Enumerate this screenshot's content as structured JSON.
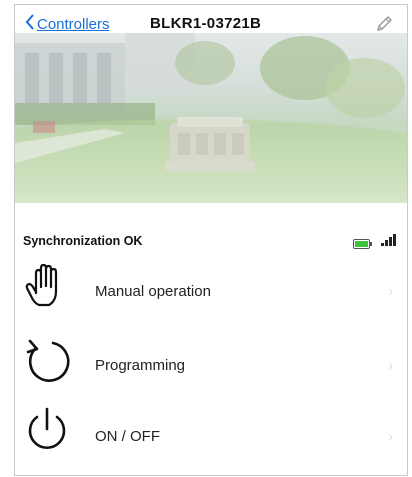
{
  "nav": {
    "back_label": "Controllers",
    "title": "BLKR1-03721B"
  },
  "status": {
    "text": "Synchronization OK"
  },
  "menu": [
    {
      "label": "Manual operation",
      "icon": "hand-icon"
    },
    {
      "label": "Programming",
      "icon": "cycle-icon"
    },
    {
      "label": "ON / OFF",
      "icon": "power-icon"
    }
  ],
  "colors": {
    "link": "#1b6fd8",
    "battery": "#3cc33c"
  }
}
